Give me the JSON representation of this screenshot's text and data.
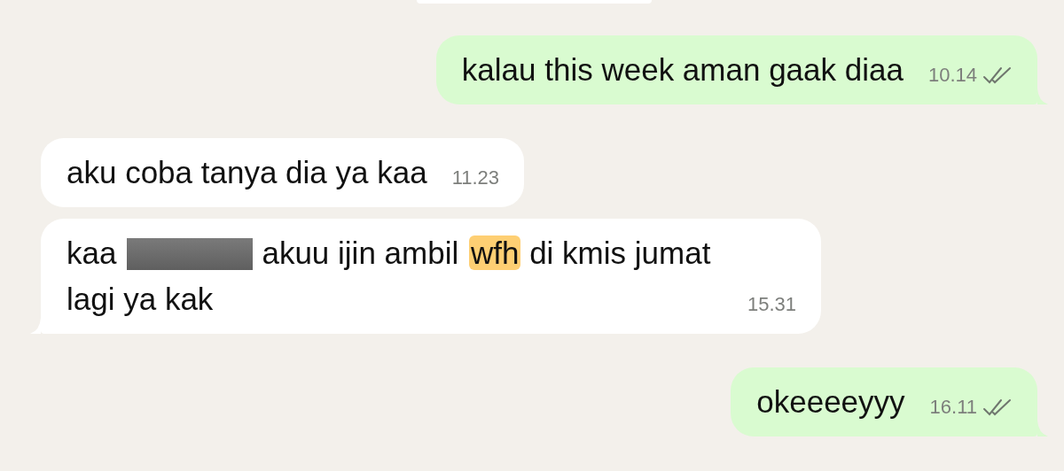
{
  "messages": [
    {
      "kind": "outgoing",
      "parts": [
        {
          "kind": "text",
          "text": "kalau this week aman gaak diaa"
        }
      ],
      "time": "10.14",
      "delivered": true
    },
    {
      "kind": "incoming",
      "parts": [
        {
          "kind": "text",
          "text": "aku coba tanya dia ya kaa"
        }
      ],
      "time": "11.23"
    },
    {
      "kind": "incoming",
      "parts": [
        {
          "kind": "text",
          "text": "kaa"
        },
        {
          "kind": "redacted"
        },
        {
          "kind": "text",
          "text": "akuu ijin ambil"
        },
        {
          "kind": "highlight",
          "text": "wfh"
        },
        {
          "kind": "text",
          "text": "di kmis jumat lagi ya kak"
        }
      ],
      "time": "15.31"
    },
    {
      "kind": "outgoing",
      "parts": [
        {
          "kind": "text",
          "text": "okeeeeyyy"
        }
      ],
      "time": "16.11",
      "delivered": true
    }
  ]
}
